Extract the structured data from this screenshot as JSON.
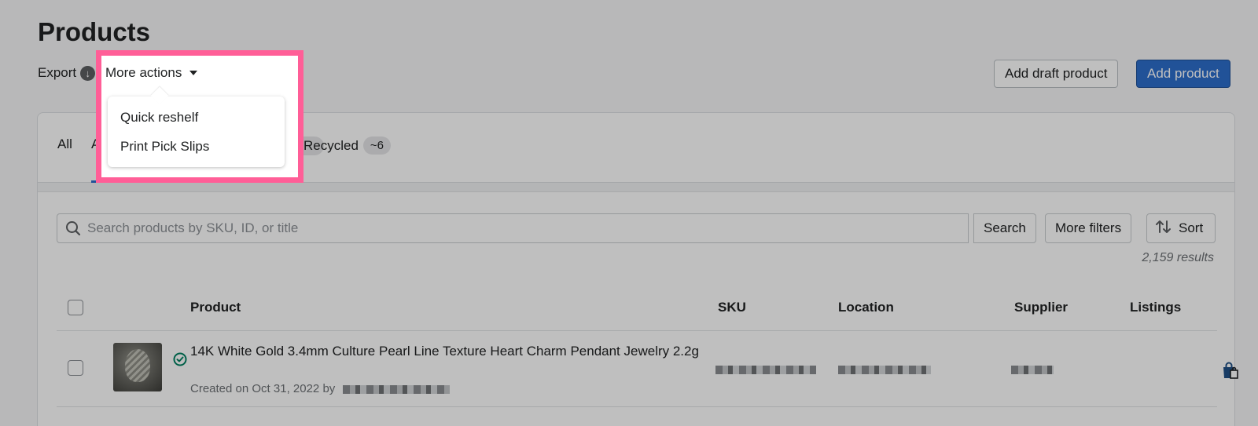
{
  "page": {
    "title": "Products",
    "export_label": "Export",
    "more_actions_label": "More actions"
  },
  "dropdown": {
    "items": [
      {
        "label": "Quick reshelf"
      },
      {
        "label": "Print Pick Slips"
      }
    ]
  },
  "header_buttons": {
    "add_draft": "Add draft product",
    "add_product": "Add product"
  },
  "tabs": [
    {
      "label": "All"
    },
    {
      "label": "A",
      "active": true
    },
    {
      "label": "Recycled",
      "badge": "~6"
    }
  ],
  "search": {
    "placeholder": "Search products by SKU, ID, or title",
    "search_label": "Search",
    "filters_label": "More filters",
    "sort_label": "Sort"
  },
  "results_count": "2,159 results",
  "table": {
    "columns": [
      "Product",
      "SKU",
      "Location",
      "Supplier",
      "Listings"
    ],
    "rows": [
      {
        "title": "14K White Gold 3.4mm Culture Pearl Line Texture Heart Charm Pendant Jewelry 2.2g",
        "meta": "Created on Oct 31, 2022 by",
        "status_icon": "check-circle-icon",
        "listing_icon": "shopping-bag-icon"
      }
    ]
  },
  "colors": {
    "primary": "#2c6ecb",
    "highlight": "#ff5e97",
    "overlay": "rgba(0,0,0,0.25)",
    "status_green": "#008060"
  }
}
